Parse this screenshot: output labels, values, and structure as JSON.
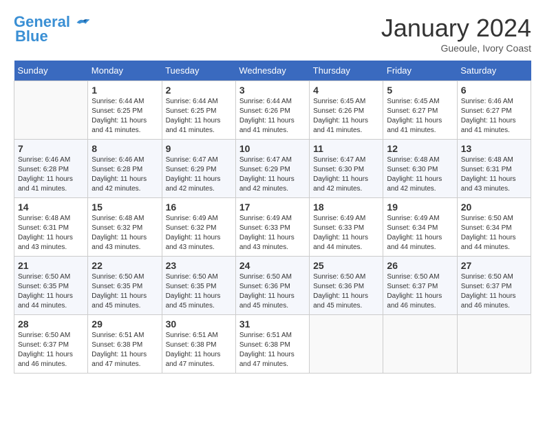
{
  "header": {
    "logo_line1": "General",
    "logo_line2": "Blue",
    "month": "January 2024",
    "location": "Gueoule, Ivory Coast"
  },
  "days_of_week": [
    "Sunday",
    "Monday",
    "Tuesday",
    "Wednesday",
    "Thursday",
    "Friday",
    "Saturday"
  ],
  "weeks": [
    [
      {
        "day": "",
        "sunrise": "",
        "sunset": "",
        "daylight": ""
      },
      {
        "day": "1",
        "sunrise": "6:44 AM",
        "sunset": "6:25 PM",
        "daylight": "11 hours and 41 minutes."
      },
      {
        "day": "2",
        "sunrise": "6:44 AM",
        "sunset": "6:25 PM",
        "daylight": "11 hours and 41 minutes."
      },
      {
        "day": "3",
        "sunrise": "6:44 AM",
        "sunset": "6:26 PM",
        "daylight": "11 hours and 41 minutes."
      },
      {
        "day": "4",
        "sunrise": "6:45 AM",
        "sunset": "6:26 PM",
        "daylight": "11 hours and 41 minutes."
      },
      {
        "day": "5",
        "sunrise": "6:45 AM",
        "sunset": "6:27 PM",
        "daylight": "11 hours and 41 minutes."
      },
      {
        "day": "6",
        "sunrise": "6:46 AM",
        "sunset": "6:27 PM",
        "daylight": "11 hours and 41 minutes."
      }
    ],
    [
      {
        "day": "7",
        "sunrise": "6:46 AM",
        "sunset": "6:28 PM",
        "daylight": "11 hours and 41 minutes."
      },
      {
        "day": "8",
        "sunrise": "6:46 AM",
        "sunset": "6:28 PM",
        "daylight": "11 hours and 42 minutes."
      },
      {
        "day": "9",
        "sunrise": "6:47 AM",
        "sunset": "6:29 PM",
        "daylight": "11 hours and 42 minutes."
      },
      {
        "day": "10",
        "sunrise": "6:47 AM",
        "sunset": "6:29 PM",
        "daylight": "11 hours and 42 minutes."
      },
      {
        "day": "11",
        "sunrise": "6:47 AM",
        "sunset": "6:30 PM",
        "daylight": "11 hours and 42 minutes."
      },
      {
        "day": "12",
        "sunrise": "6:48 AM",
        "sunset": "6:30 PM",
        "daylight": "11 hours and 42 minutes."
      },
      {
        "day": "13",
        "sunrise": "6:48 AM",
        "sunset": "6:31 PM",
        "daylight": "11 hours and 43 minutes."
      }
    ],
    [
      {
        "day": "14",
        "sunrise": "6:48 AM",
        "sunset": "6:31 PM",
        "daylight": "11 hours and 43 minutes."
      },
      {
        "day": "15",
        "sunrise": "6:48 AM",
        "sunset": "6:32 PM",
        "daylight": "11 hours and 43 minutes."
      },
      {
        "day": "16",
        "sunrise": "6:49 AM",
        "sunset": "6:32 PM",
        "daylight": "11 hours and 43 minutes."
      },
      {
        "day": "17",
        "sunrise": "6:49 AM",
        "sunset": "6:33 PM",
        "daylight": "11 hours and 43 minutes."
      },
      {
        "day": "18",
        "sunrise": "6:49 AM",
        "sunset": "6:33 PM",
        "daylight": "11 hours and 44 minutes."
      },
      {
        "day": "19",
        "sunrise": "6:49 AM",
        "sunset": "6:34 PM",
        "daylight": "11 hours and 44 minutes."
      },
      {
        "day": "20",
        "sunrise": "6:50 AM",
        "sunset": "6:34 PM",
        "daylight": "11 hours and 44 minutes."
      }
    ],
    [
      {
        "day": "21",
        "sunrise": "6:50 AM",
        "sunset": "6:35 PM",
        "daylight": "11 hours and 44 minutes."
      },
      {
        "day": "22",
        "sunrise": "6:50 AM",
        "sunset": "6:35 PM",
        "daylight": "11 hours and 45 minutes."
      },
      {
        "day": "23",
        "sunrise": "6:50 AM",
        "sunset": "6:35 PM",
        "daylight": "11 hours and 45 minutes."
      },
      {
        "day": "24",
        "sunrise": "6:50 AM",
        "sunset": "6:36 PM",
        "daylight": "11 hours and 45 minutes."
      },
      {
        "day": "25",
        "sunrise": "6:50 AM",
        "sunset": "6:36 PM",
        "daylight": "11 hours and 45 minutes."
      },
      {
        "day": "26",
        "sunrise": "6:50 AM",
        "sunset": "6:37 PM",
        "daylight": "11 hours and 46 minutes."
      },
      {
        "day": "27",
        "sunrise": "6:50 AM",
        "sunset": "6:37 PM",
        "daylight": "11 hours and 46 minutes."
      }
    ],
    [
      {
        "day": "28",
        "sunrise": "6:50 AM",
        "sunset": "6:37 PM",
        "daylight": "11 hours and 46 minutes."
      },
      {
        "day": "29",
        "sunrise": "6:51 AM",
        "sunset": "6:38 PM",
        "daylight": "11 hours and 47 minutes."
      },
      {
        "day": "30",
        "sunrise": "6:51 AM",
        "sunset": "6:38 PM",
        "daylight": "11 hours and 47 minutes."
      },
      {
        "day": "31",
        "sunrise": "6:51 AM",
        "sunset": "6:38 PM",
        "daylight": "11 hours and 47 minutes."
      },
      {
        "day": "",
        "sunrise": "",
        "sunset": "",
        "daylight": ""
      },
      {
        "day": "",
        "sunrise": "",
        "sunset": "",
        "daylight": ""
      },
      {
        "day": "",
        "sunrise": "",
        "sunset": "",
        "daylight": ""
      }
    ]
  ]
}
